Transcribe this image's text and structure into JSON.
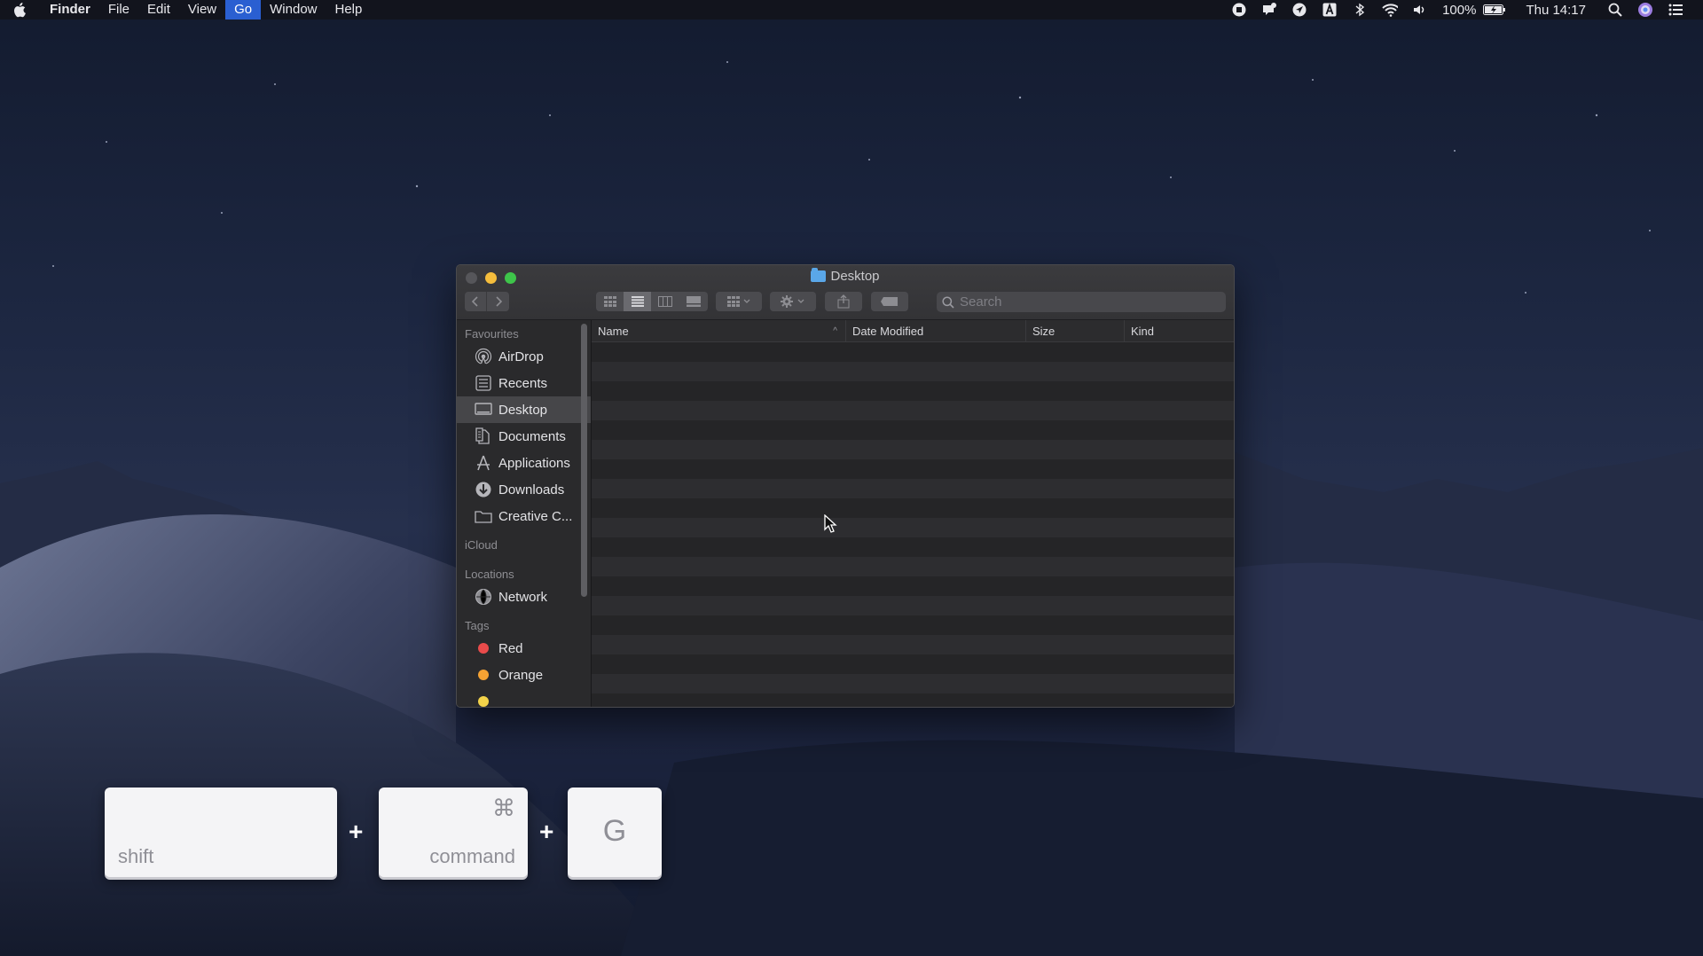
{
  "menubar": {
    "app_name": "Finder",
    "items": [
      "File",
      "Edit",
      "View",
      "Go",
      "Window",
      "Help"
    ],
    "active_item": "Go",
    "battery": "100%",
    "clock": "Thu 14:17"
  },
  "window": {
    "title": "Desktop",
    "search_placeholder": "Search",
    "columns": {
      "name": "Name",
      "date_modified": "Date Modified",
      "size": "Size",
      "kind": "Kind"
    }
  },
  "sidebar": {
    "favourites_heading": "Favourites",
    "favourites": [
      {
        "label": "AirDrop",
        "icon": "airdrop-icon"
      },
      {
        "label": "Recents",
        "icon": "recents-icon"
      },
      {
        "label": "Desktop",
        "icon": "desktop-icon",
        "selected": true
      },
      {
        "label": "Documents",
        "icon": "documents-icon"
      },
      {
        "label": "Applications",
        "icon": "applications-icon"
      },
      {
        "label": "Downloads",
        "icon": "downloads-icon"
      },
      {
        "label": "Creative C...",
        "icon": "folder-icon"
      }
    ],
    "icloud_heading": "iCloud",
    "locations_heading": "Locations",
    "locations": [
      {
        "label": "Network",
        "icon": "network-icon"
      }
    ],
    "tags_heading": "Tags",
    "tags": [
      {
        "label": "Red",
        "color": "#e94b4b"
      },
      {
        "label": "Orange",
        "color": "#f5a233"
      }
    ]
  },
  "shortcut": {
    "key1_label": "shift",
    "key2_symbol": "⌘",
    "key2_label": "command",
    "key3_label": "G",
    "plus": "+"
  }
}
